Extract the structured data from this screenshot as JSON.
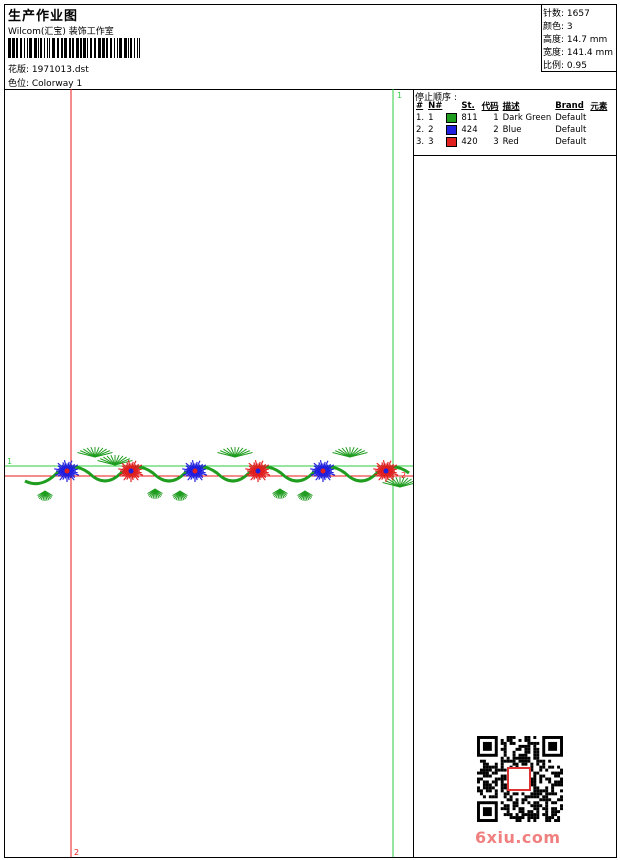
{
  "header": {
    "title": "生产作业图",
    "subtitle": "Wilcom(汇宝) 装饰工作室",
    "design_label": "花版: 1971013.dst",
    "colorway_label": "色位: Colorway 1"
  },
  "stats": {
    "stitches": "针数: 1657",
    "colors": "颜色: 3",
    "height": "高度: 14.7 mm",
    "width": "宽度: 141.4 mm",
    "scale": "比例: 0.95"
  },
  "stop_sequence": {
    "heading": "停止顺序 :",
    "columns": [
      "#",
      "N#",
      "St.",
      "代码",
      "描述",
      "Brand",
      "元素"
    ],
    "rows": [
      {
        "index": "1.",
        "n": "1",
        "color": "#1f9d1f",
        "st": "811",
        "code": "1",
        "description": "Dark Green",
        "brand": "Default",
        "element": ""
      },
      {
        "index": "2.",
        "n": "2",
        "color": "#1f1fe0",
        "st": "424",
        "code": "2",
        "description": "Blue",
        "brand": "Default",
        "element": ""
      },
      {
        "index": "3.",
        "n": "3",
        "color": "#e01f1f",
        "st": "420",
        "code": "3",
        "description": "Red",
        "brand": "Default",
        "element": ""
      }
    ]
  },
  "guides": {
    "v_green_label": "1",
    "v_red_label": "2",
    "h_green_label": "1",
    "h_red_label": "2"
  },
  "colors": {
    "green": "#1f9d1f",
    "blue": "#1f1fe0",
    "red": "#e01f1f",
    "guide_green": "#2ecc40",
    "guide_red": "#e81818"
  },
  "watermark": "6xiu.com"
}
